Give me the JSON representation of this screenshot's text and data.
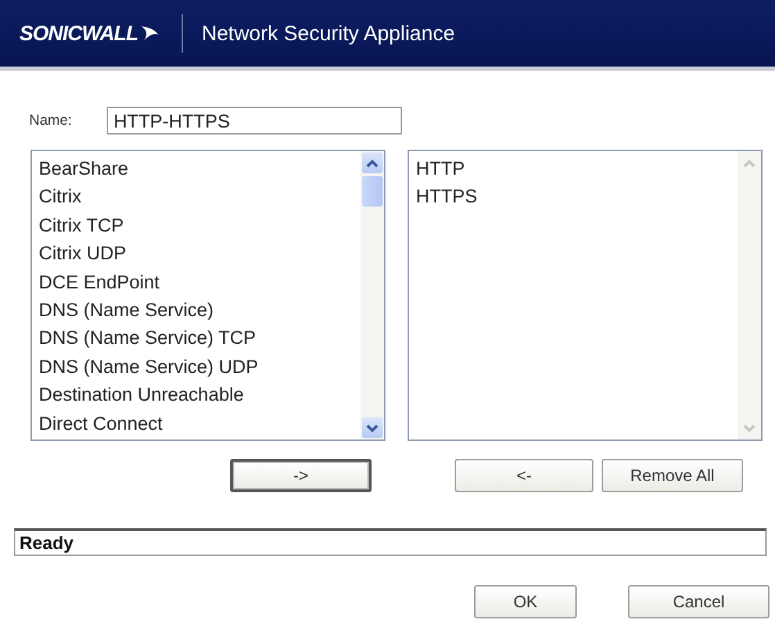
{
  "header": {
    "logo": "SONICWALL",
    "title": "Network Security Appliance"
  },
  "name_field": {
    "label": "Name:",
    "value": "HTTP-HTTPS"
  },
  "available_list": {
    "items": [
      "BearShare",
      "Citrix",
      "Citrix TCP",
      "Citrix UDP",
      "DCE EndPoint",
      "DNS (Name Service)",
      "DNS (Name Service) TCP",
      "DNS (Name Service) UDP",
      "Destination Unreachable",
      "Direct Connect"
    ]
  },
  "selected_list": {
    "items": [
      "HTTP",
      "HTTPS"
    ]
  },
  "transfer_buttons": [
    {
      "label": "->",
      "default": true
    },
    {
      "label": "<-",
      "default": false
    },
    {
      "label": "Remove All",
      "default": false
    }
  ],
  "status": "Ready",
  "dialog_buttons": [
    "OK",
    "Cancel"
  ]
}
